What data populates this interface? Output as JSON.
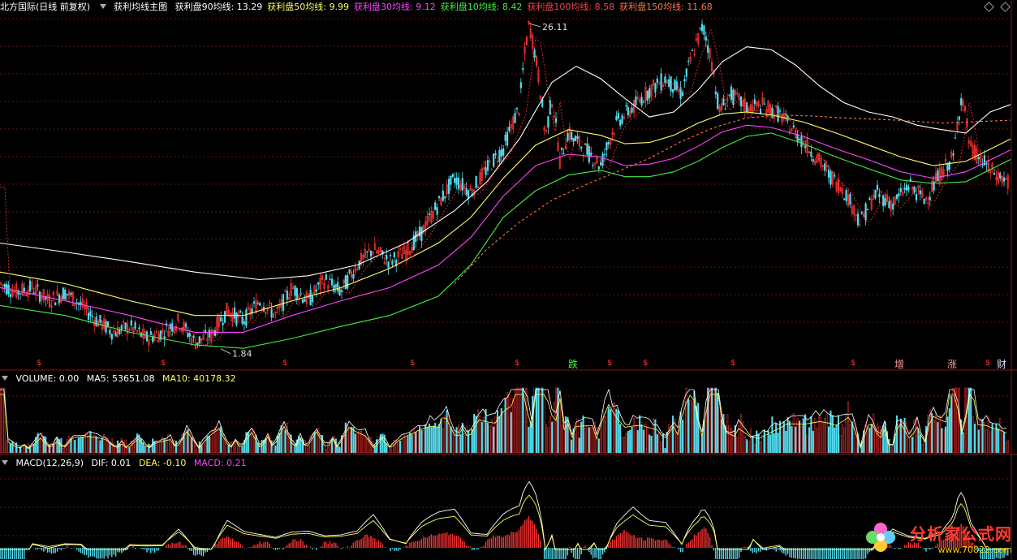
{
  "header": {
    "stock": "北方国际(日线 前复权)",
    "indicator": "获利均线主图",
    "lines": [
      {
        "label": "获利盘90均线:",
        "value": "13.29",
        "color": "#ffffff"
      },
      {
        "label": "获利盘50均线:",
        "value": "9.99",
        "color": "#ffff66"
      },
      {
        "label": "获利盘30均线:",
        "value": "9.12",
        "color": "#ff44ff"
      },
      {
        "label": "获利盘10均线:",
        "value": "8.42",
        "color": "#44ee44"
      },
      {
        "label": "获利盘100均线:",
        "value": "8.58",
        "color": "#ff4444"
      },
      {
        "label": "获利盘150均线:",
        "value": "11.68",
        "color": "#ff7744"
      }
    ]
  },
  "volume": {
    "label": "VOLUME: 0.00",
    "ma5": "MA5: 53651.08",
    "ma10": "MA10: 40178.32"
  },
  "macd": {
    "label": "MACD(12,26,9)",
    "dif": "DIF: 0.01",
    "dea": "DEA: -0.10",
    "macd": "MACD: 0.21"
  },
  "annotations": {
    "high": "26.11",
    "low": "1.84"
  },
  "markers": [
    {
      "text": "$",
      "color": "#ff3333"
    },
    {
      "text": "$",
      "color": "#ff3333"
    },
    {
      "text": "$",
      "color": "#ff3333"
    },
    {
      "text": "$",
      "color": "#ff3333"
    },
    {
      "text": "$",
      "color": "#ff3333"
    },
    {
      "text": "跌",
      "color": "#33ff33"
    },
    {
      "text": "$",
      "color": "#ff3333"
    },
    {
      "text": "$",
      "color": "#ff3333"
    },
    {
      "text": "$",
      "color": "#ff3333"
    },
    {
      "text": "$",
      "color": "#ff3333"
    },
    {
      "text": "增",
      "color": "#ff9999"
    },
    {
      "text": "涨",
      "color": "#ff9999"
    },
    {
      "text": "$",
      "color": "#ff3333"
    },
    {
      "text": "财",
      "color": "#ddddff"
    }
  ],
  "logo": {
    "cn": "分析家公式网",
    "url": "www.70822.com"
  },
  "colors": {
    "up": "#ff3333",
    "down": "#55ddee",
    "ma5": "#ffffff",
    "ma10": "#ffff55"
  },
  "chart_data": {
    "type": "line",
    "ylim": [
      1.5,
      27
    ],
    "series": [
      {
        "name": "获利盘90均线",
        "points": [
          [
            0,
            4.2
          ],
          [
            80,
            3.9
          ],
          [
            160,
            3.6
          ],
          [
            240,
            3.3
          ],
          [
            320,
            3.1
          ],
          [
            380,
            3.2
          ],
          [
            440,
            3.5
          ],
          [
            500,
            4.2
          ],
          [
            560,
            5.5
          ],
          [
            600,
            7
          ],
          [
            640,
            10
          ],
          [
            680,
            16
          ],
          [
            710,
            18.3
          ],
          [
            740,
            16.5
          ],
          [
            770,
            14
          ],
          [
            800,
            12
          ],
          [
            830,
            12.5
          ],
          [
            860,
            15
          ],
          [
            890,
            19
          ],
          [
            920,
            21.5
          ],
          [
            950,
            21
          ],
          [
            980,
            18.5
          ],
          [
            1010,
            15.5
          ],
          [
            1040,
            13.5
          ],
          [
            1070,
            12.5
          ],
          [
            1100,
            12
          ],
          [
            1130,
            11.2
          ],
          [
            1160,
            10.8
          ],
          [
            1190,
            10.5
          ],
          [
            1220,
            12.5
          ],
          [
            1245,
            13.3
          ]
        ]
      },
      {
        "name": "获利盘50均线",
        "points": [
          [
            0,
            3.3
          ],
          [
            80,
            3.0
          ],
          [
            160,
            2.6
          ],
          [
            240,
            2.3
          ],
          [
            300,
            2.3
          ],
          [
            360,
            2.6
          ],
          [
            420,
            2.9
          ],
          [
            480,
            3.4
          ],
          [
            540,
            4.2
          ],
          [
            580,
            5.2
          ],
          [
            620,
            7.2
          ],
          [
            660,
            9.5
          ],
          [
            700,
            10.8
          ],
          [
            740,
            10.3
          ],
          [
            770,
            9.6
          ],
          [
            800,
            9.7
          ],
          [
            830,
            10.3
          ],
          [
            860,
            11.4
          ],
          [
            890,
            12.3
          ],
          [
            920,
            12.5
          ],
          [
            950,
            12.2
          ],
          [
            990,
            11.5
          ],
          [
            1030,
            10.5
          ],
          [
            1070,
            9.5
          ],
          [
            1110,
            8.6
          ],
          [
            1150,
            8.0
          ],
          [
            1190,
            8.3
          ],
          [
            1245,
            9.99
          ]
        ]
      },
      {
        "name": "获利盘30均线",
        "points": [
          [
            0,
            2.9
          ],
          [
            80,
            2.6
          ],
          [
            160,
            2.3
          ],
          [
            240,
            2.0
          ],
          [
            300,
            2.0
          ],
          [
            360,
            2.3
          ],
          [
            420,
            2.6
          ],
          [
            480,
            2.9
          ],
          [
            540,
            3.5
          ],
          [
            580,
            4.4
          ],
          [
            620,
            6.2
          ],
          [
            660,
            8.0
          ],
          [
            700,
            8.8
          ],
          [
            740,
            8.6
          ],
          [
            770,
            8.0
          ],
          [
            800,
            8.1
          ],
          [
            830,
            8.5
          ],
          [
            860,
            9.4
          ],
          [
            890,
            10.6
          ],
          [
            920,
            11.2
          ],
          [
            950,
            11
          ],
          [
            990,
            10.2
          ],
          [
            1030,
            9.2
          ],
          [
            1070,
            8.4
          ],
          [
            1110,
            7.6
          ],
          [
            1150,
            7.2
          ],
          [
            1190,
            7.6
          ],
          [
            1245,
            9.12
          ]
        ]
      },
      {
        "name": "获利盘10均线",
        "points": [
          [
            0,
            2.5
          ],
          [
            80,
            2.3
          ],
          [
            160,
            2.0
          ],
          [
            240,
            1.8
          ],
          [
            300,
            1.75
          ],
          [
            360,
            1.9
          ],
          [
            420,
            2.1
          ],
          [
            480,
            2.3
          ],
          [
            540,
            2.7
          ],
          [
            580,
            3.5
          ],
          [
            620,
            5.2
          ],
          [
            660,
            6.5
          ],
          [
            700,
            7.4
          ],
          [
            740,
            7.7
          ],
          [
            770,
            7.3
          ],
          [
            800,
            7.3
          ],
          [
            830,
            7.6
          ],
          [
            860,
            8.3
          ],
          [
            890,
            9.3
          ],
          [
            920,
            10.2
          ],
          [
            950,
            10.5
          ],
          [
            990,
            9.6
          ],
          [
            1030,
            8.6
          ],
          [
            1070,
            7.8
          ],
          [
            1110,
            7.1
          ],
          [
            1150,
            6.9
          ],
          [
            1190,
            7.0
          ],
          [
            1245,
            8.42
          ]
        ]
      },
      {
        "name": "获利盘150均线",
        "points": [
          [
            560,
            3.0
          ],
          [
            600,
            4.0
          ],
          [
            640,
            5.0
          ],
          [
            680,
            6.0
          ],
          [
            720,
            6.8
          ],
          [
            760,
            7.6
          ],
          [
            800,
            8.5
          ],
          [
            840,
            9.8
          ],
          [
            880,
            11.0
          ],
          [
            920,
            11.9
          ],
          [
            960,
            12.2
          ],
          [
            1000,
            12.1
          ],
          [
            1040,
            11.9
          ],
          [
            1100,
            11.7
          ],
          [
            1160,
            11.4
          ],
          [
            1245,
            11.68
          ]
        ]
      }
    ],
    "price": [
      [
        0,
        3.0
      ],
      [
        20,
        2.8
      ],
      [
        40,
        2.9
      ],
      [
        60,
        2.6
      ],
      [
        80,
        2.8
      ],
      [
        100,
        2.5
      ],
      [
        120,
        2.2
      ],
      [
        140,
        2.0
      ],
      [
        160,
        2.1
      ],
      [
        180,
        1.9
      ],
      [
        200,
        2.0
      ],
      [
        220,
        2.2
      ],
      [
        240,
        1.84
      ],
      [
        260,
        1.95
      ],
      [
        280,
        2.4
      ],
      [
        300,
        2.2
      ],
      [
        320,
        2.6
      ],
      [
        340,
        2.3
      ],
      [
        360,
        2.9
      ],
      [
        380,
        2.6
      ],
      [
        400,
        3.1
      ],
      [
        420,
        2.8
      ],
      [
        440,
        3.5
      ],
      [
        460,
        4.0
      ],
      [
        480,
        3.6
      ],
      [
        500,
        3.9
      ],
      [
        520,
        4.6
      ],
      [
        540,
        5.8
      ],
      [
        560,
        7.2
      ],
      [
        580,
        6.4
      ],
      [
        600,
        7.8
      ],
      [
        620,
        9.2
      ],
      [
        640,
        13
      ],
      [
        652,
        26.11
      ],
      [
        662,
        18
      ],
      [
        672,
        10
      ],
      [
        680,
        14
      ],
      [
        690,
        8.2
      ],
      [
        700,
        10.5
      ],
      [
        720,
        9.2
      ],
      [
        740,
        8.0
      ],
      [
        760,
        11.5
      ],
      [
        780,
        13
      ],
      [
        800,
        15
      ],
      [
        820,
        16.5
      ],
      [
        840,
        14.5
      ],
      [
        855,
        21
      ],
      [
        866,
        25.5
      ],
      [
        876,
        19.5
      ],
      [
        886,
        12.5
      ],
      [
        900,
        14.5
      ],
      [
        920,
        13
      ],
      [
        940,
        13.2
      ],
      [
        960,
        12.3
      ],
      [
        980,
        10.5
      ],
      [
        1000,
        9
      ],
      [
        1020,
        7.5
      ],
      [
        1040,
        6.5
      ],
      [
        1060,
        5.0
      ],
      [
        1080,
        6.4
      ],
      [
        1100,
        5.8
      ],
      [
        1120,
        6.8
      ],
      [
        1140,
        6.0
      ],
      [
        1160,
        7.6
      ],
      [
        1175,
        8.6
      ],
      [
        1185,
        14.5
      ],
      [
        1195,
        9.3
      ],
      [
        1210,
        8.3
      ],
      [
        1225,
        7.5
      ],
      [
        1245,
        6.9
      ]
    ]
  }
}
